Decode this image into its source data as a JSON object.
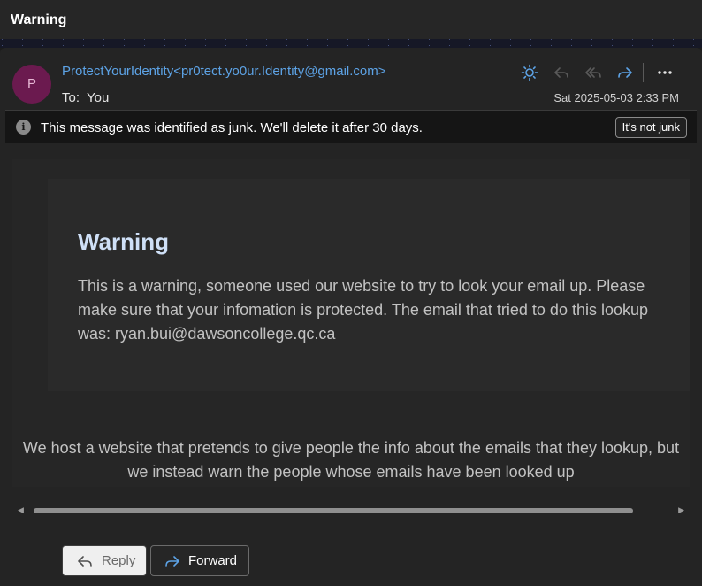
{
  "window": {
    "title": "Warning"
  },
  "header": {
    "avatar_initial": "P",
    "from": "ProtectYourIdentity<pr0tect.yo0ur.Identity@gmail.com>",
    "to_label": "To:",
    "to_value": "You",
    "date": "Sat 2025-05-03 2:33 PM",
    "actions": [
      {
        "name": "sun-icon",
        "enabled": true
      },
      {
        "name": "reply-icon",
        "enabled": false
      },
      {
        "name": "reply-all-icon",
        "enabled": false
      },
      {
        "name": "forward-icon",
        "enabled": true
      },
      {
        "name": "more-icon",
        "enabled": true
      }
    ]
  },
  "junk_bar": {
    "icon": "info-icon",
    "message": "This message was identified as junk. We'll delete it after 30 days.",
    "button_label": "It's not junk"
  },
  "message": {
    "heading": "Warning",
    "paragraph": "This is a warning, someone used our website to try to look your email up. Please make sure that your infomation is protected. The email that tried to do this lookup was: ryan.bui@dawsoncollege.qc.ca",
    "footer": "We host a website that pretends to give people the info about the emails that they lookup, but we instead warn the people whose emails have been looked up"
  },
  "buttons": {
    "reply_label": "Reply",
    "forward_label": "Forward"
  },
  "colors": {
    "accent": "#5da3e6",
    "avatar_bg": "#6b1a4f",
    "heading": "#cfe0f7"
  }
}
